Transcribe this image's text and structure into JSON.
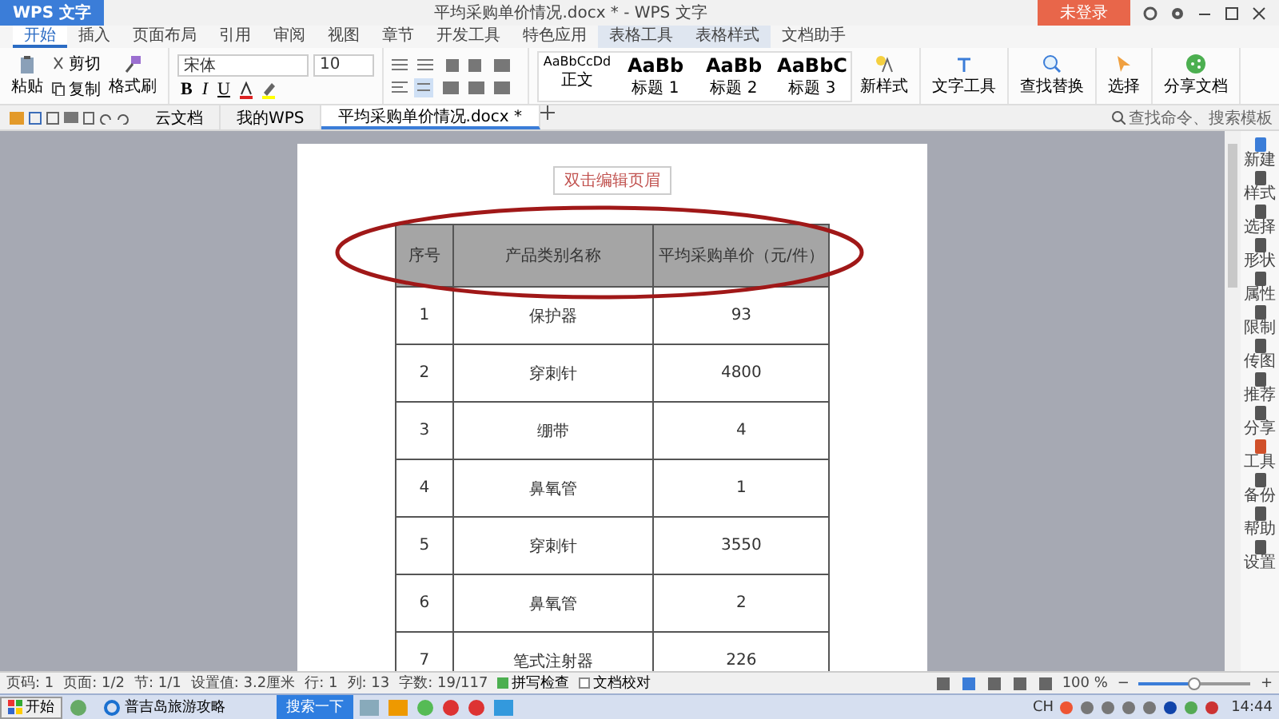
{
  "app": {
    "logo": "WPS 文字",
    "title": "平均采购单价情况.docx * - WPS 文字",
    "login_button": "未登录"
  },
  "menu_tabs": [
    {
      "label": "开始",
      "selected": true
    },
    {
      "label": "插入",
      "selected": false
    },
    {
      "label": "页面布局",
      "selected": false
    },
    {
      "label": "引用",
      "selected": false
    },
    {
      "label": "审阅",
      "selected": false
    },
    {
      "label": "视图",
      "selected": false
    },
    {
      "label": "章节",
      "selected": false
    },
    {
      "label": "开发工具",
      "selected": false
    },
    {
      "label": "特色应用",
      "selected": false
    },
    {
      "label": "表格工具",
      "selected": false
    },
    {
      "label": "表格样式",
      "selected": false
    },
    {
      "label": "文档助手",
      "selected": false
    }
  ],
  "ribbon": {
    "paste": "粘贴",
    "cut": "剪切",
    "copy": "复制",
    "format_painter": "格式刷",
    "font_name": "宋体",
    "font_size": "10",
    "format_buttons": [
      "B",
      "I",
      "U"
    ],
    "styles": [
      {
        "preview": "AaBbCcDd",
        "name": "正文"
      },
      {
        "preview": "AaBb",
        "name": "标题 1"
      },
      {
        "preview": "AaBb",
        "name": "标题 2"
      },
      {
        "preview": "AaBbC",
        "name": "标题 3"
      }
    ],
    "new_style": "新样式",
    "tools": [
      {
        "kind": "text",
        "label": "文字工具"
      },
      {
        "kind": "find",
        "label": "查找替换"
      },
      {
        "kind": "select",
        "label": "选择"
      },
      {
        "kind": "share",
        "label": "分享文档"
      }
    ]
  },
  "doc_tabs": [
    {
      "label": "云文档",
      "selected": false
    },
    {
      "label": "我的WPS",
      "selected": false
    },
    {
      "label": "平均采购单价情况.docx *",
      "selected": true
    }
  ],
  "command_search": {
    "placeholder": "查找命令、搜索模板"
  },
  "document": {
    "header_hint": "双击编辑页眉",
    "table": {
      "columns": [
        "序号",
        "产品类别名称",
        "平均采购单价（元/件）"
      ],
      "rows": [
        [
          "1",
          "保护器",
          "93"
        ],
        [
          "2",
          "穿刺针",
          "4800"
        ],
        [
          "3",
          "绷带",
          "4"
        ],
        [
          "4",
          "鼻氧管",
          "1"
        ],
        [
          "5",
          "穿刺针",
          "3550"
        ],
        [
          "6",
          "鼻氧管",
          "2"
        ],
        [
          "7",
          "笔式注射器",
          "226"
        ]
      ]
    }
  },
  "sidebar": [
    "新建",
    "样式",
    "选择",
    "形状",
    "属性",
    "限制",
    "传图",
    "推荐",
    "分享",
    "工具",
    "备份",
    "帮助",
    "设置"
  ],
  "status_bar": {
    "items": [
      "页码: 1",
      "页面: 1/2",
      "节: 1/1",
      "设置值: 3.2厘米",
      "行: 1",
      "列: 13",
      "字数: 19/117"
    ],
    "spell_check": {
      "label": "拼写检查",
      "checked": true
    },
    "proofread": {
      "label": "文档校对",
      "checked": false
    },
    "zoom": "100 %",
    "zoom_out": "−",
    "zoom_in": "+",
    "zoom_slider": {
      "level": 0.5
    }
  },
  "taskbar": {
    "start": "开始",
    "window": "普吉岛旅游攻略",
    "search_button": "搜索一下",
    "ime": "CH",
    "clock": "14:44"
  }
}
